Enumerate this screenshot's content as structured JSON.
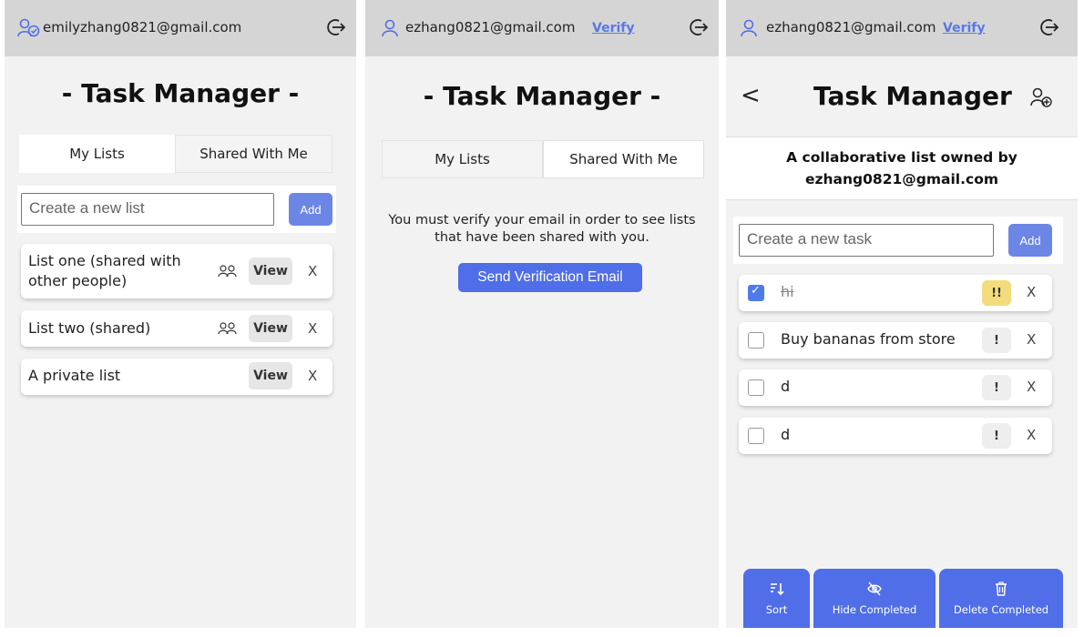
{
  "panel1": {
    "email": "emilyzhang0821@gmail.com",
    "title": "- Task Manager -",
    "tabs": [
      "My Lists",
      "Shared With Me"
    ],
    "new_list_placeholder": "Create a new list",
    "add_label": "Add",
    "lists": [
      {
        "name_line1": "List one (shared with",
        "name_line2": "other people)",
        "shared": true
      },
      {
        "name": "List two (shared)",
        "shared": true
      },
      {
        "name": "A private list",
        "shared": false
      }
    ],
    "view_label": "View",
    "delete_label": "X"
  },
  "panel2": {
    "email": "ezhang0821@gmail.com",
    "verify_label": "Verify",
    "title": "- Task Manager -",
    "tabs": [
      "My Lists",
      "Shared With Me"
    ],
    "message_line1": "You must verify your email in order to see lists",
    "message_line2": "that have been shared with you.",
    "send_label": "Send Verification Email"
  },
  "panel3": {
    "email": "ezhang0821@gmail.com",
    "verify_label": "Verify",
    "back_label": "<",
    "title": "Task Manager",
    "owner_line1": "A collaborative list owned by",
    "owner_line2": "ezhang0821@gmail.com",
    "new_task_placeholder": "Create a new task",
    "add_label": "Add",
    "tasks": [
      {
        "text": "hi",
        "completed": true,
        "priority": "!!"
      },
      {
        "text": "Buy bananas from store",
        "completed": false,
        "priority": "!"
      },
      {
        "text": "d",
        "completed": false,
        "priority": "!"
      },
      {
        "text": "d",
        "completed": false,
        "priority": "!"
      }
    ],
    "delete_label": "X",
    "bottom": {
      "sort_label": "Sort",
      "hide_label": "Hide Completed",
      "delete_label": "Delete Completed"
    }
  },
  "colors": {
    "accent": "#4f6ee8",
    "add_button": "#6c86e6",
    "topbar": "#d5d5d5",
    "background": "#f2f2f2",
    "high_priority": "#f3dc7e"
  },
  "icons": {
    "user": "user-icon",
    "logout": "logout-icon",
    "shared": "people-icon",
    "add_collaborator": "user-add-icon",
    "sort": "sort-icon",
    "hide": "eye-slash-icon",
    "trash": "trash-icon"
  }
}
